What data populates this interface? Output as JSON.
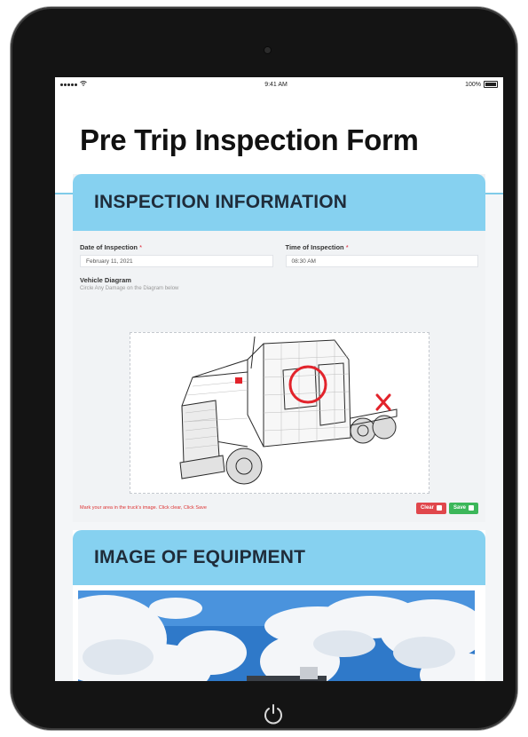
{
  "device": {
    "status_bar": {
      "carrier": "•••••",
      "time": "9:41 AM",
      "battery": "100%"
    },
    "home_icon": "power-icon"
  },
  "page": {
    "title": "Pre Trip Inspection Form",
    "accent_color": "#86d1f0"
  },
  "inspection": {
    "heading": "INSPECTION INFORMATION",
    "date_label": "Date of Inspection",
    "date_value": "February 11, 2021",
    "time_label": "Time of Inspection",
    "time_value": "08:30 AM",
    "required_mark": "*",
    "diagram_label": "Vehicle Diagram",
    "diagram_hint": "Circle Any Damage on the Diagram below",
    "footer_note": "Mark your area in the truck's image. Click clear, Click Save",
    "clear_label": "Clear",
    "save_label": "Save"
  },
  "equipment": {
    "heading": "IMAGE OF EQUIPMENT"
  },
  "colors": {
    "clear_button": "#e0474c",
    "save_button": "#3cb75a",
    "markup": "#e2232b"
  }
}
